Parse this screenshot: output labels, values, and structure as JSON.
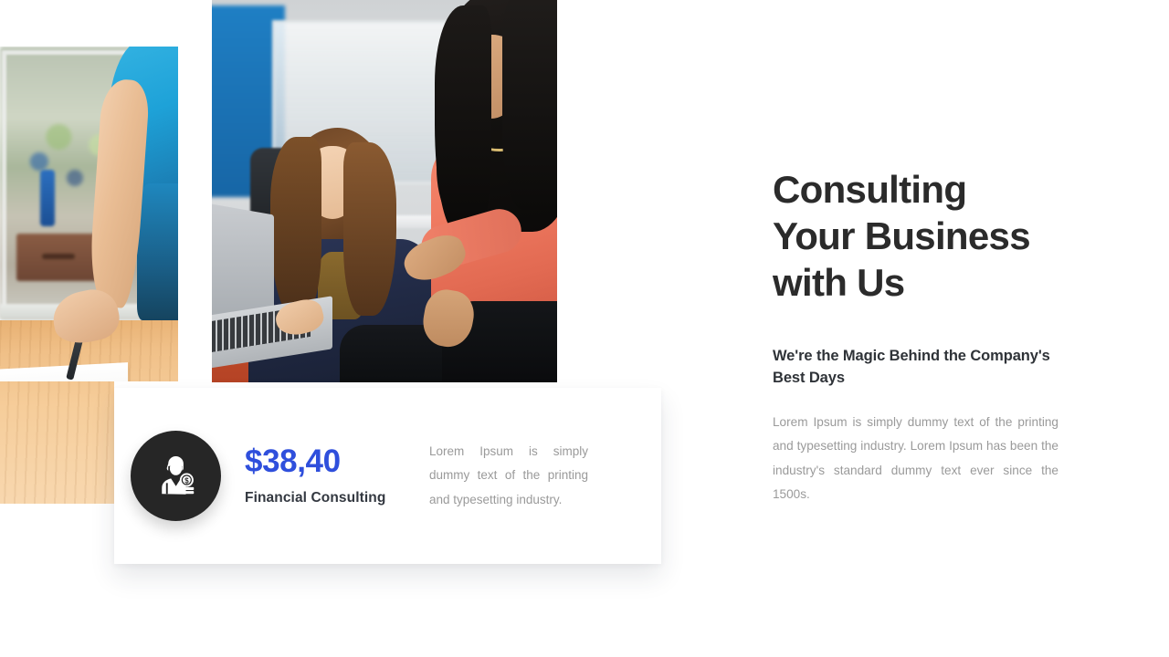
{
  "slide": {
    "background_color": "#ffffff",
    "accent_color": "#2f4fdc",
    "heading_color": "#2b2b2b",
    "body_color": "#9a9a9a",
    "icon_badge_color": "#262626"
  },
  "images": {
    "left": {
      "name": "hand-writing-on-paper-photo",
      "description": "Person in teal shirt writing with a pen on white paper at a wooden desk"
    },
    "center": {
      "name": "two-women-with-laptop-photo",
      "description": "Two women in an office, one in navy blazer with a laptop on an orange couch, one in coral top"
    }
  },
  "price_card": {
    "icon": "financial-advisor-icon",
    "price": "$38,40",
    "service_label": "Financial Consulting",
    "description": "Lorem Ipsum is simply dummy text of the printing and typesetting industry."
  },
  "right_column": {
    "headline": "Consulting Your Business with Us",
    "headline_lines": [
      "Consulting",
      "Your Business",
      "with Us"
    ],
    "subheading": "We're the Magic Behind the Company's Best Days",
    "body": "Lorem Ipsum is simply dummy text of the printing and typesetting industry.  Lorem Ipsum has been the industry's standard dummy text ever since the 1500s."
  }
}
